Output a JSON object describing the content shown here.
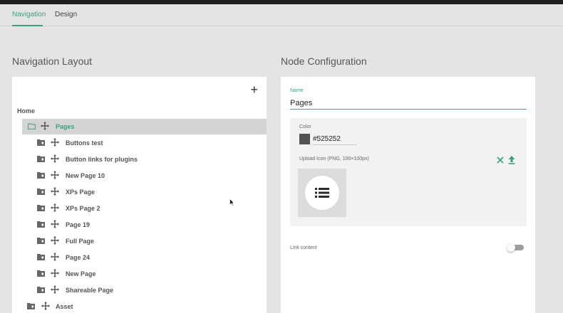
{
  "tabs": [
    {
      "label": "Navigation",
      "active": true
    },
    {
      "label": "Design",
      "active": false
    }
  ],
  "left": {
    "title": "Navigation Layout",
    "add_label": "+",
    "root_label": "Home",
    "selected": {
      "label": "Pages",
      "icon": "folder-outline-icon"
    },
    "children": [
      {
        "label": "Buttons test"
      },
      {
        "label": "Button links for plugins"
      },
      {
        "label": "New Page 10"
      },
      {
        "label": "XPs Page"
      },
      {
        "label": "XPs Page 2"
      },
      {
        "label": "Page 19"
      },
      {
        "label": "Full Page"
      },
      {
        "label": "Page 24"
      },
      {
        "label": "New Page"
      },
      {
        "label": "Shareable Page"
      }
    ],
    "last": {
      "label": "Asset"
    }
  },
  "right": {
    "title": "Node Configuration",
    "name_label": "Name",
    "name_value": "Pages",
    "color_label": "Color",
    "color_value": "#525252",
    "upload_label": "Upload Icon (PNG, 100×100px)",
    "preview_icon": "list-icon",
    "link_label": "Link content",
    "link_enabled": false
  },
  "colors": {
    "accent": "#3aa37a",
    "swatch": "#525252",
    "background": "#e4e4e4"
  }
}
